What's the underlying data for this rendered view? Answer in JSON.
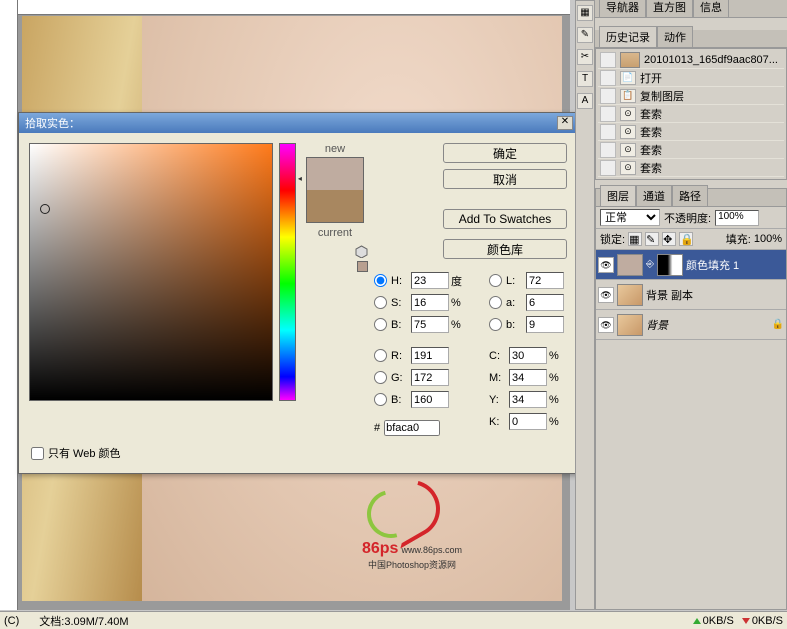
{
  "nav_tabs": {
    "navigator": "导航器",
    "histogram": "直方图",
    "info": "信息"
  },
  "history": {
    "tab_history": "历史记录",
    "tab_actions": "动作",
    "snapshot": "20101013_165df9aac807...",
    "items": [
      "打开",
      "复制图层",
      "套索",
      "套索",
      "套索",
      "套索"
    ]
  },
  "dialog": {
    "title": "拾取实色：",
    "new_label": "new",
    "current_label": "current",
    "ok": "确定",
    "cancel": "取消",
    "add_swatches": "Add To Swatches",
    "color_lib": "颜色库",
    "web_only": "只有 Web 颜色",
    "hsb": {
      "h_label": "H:",
      "s_label": "S:",
      "b_label": "B:",
      "h": "23",
      "s": "16",
      "b": "75",
      "h_unit": "度",
      "pct": "%"
    },
    "lab": {
      "l_label": "L:",
      "a_label": "a:",
      "b_label": "b:",
      "l": "72",
      "a": "6",
      "b": "9"
    },
    "rgb": {
      "r_label": "R:",
      "g_label": "G:",
      "b_label": "B:",
      "r": "191",
      "g": "172",
      "b": "160"
    },
    "cmyk": {
      "c_label": "C:",
      "m_label": "M:",
      "y_label": "Y:",
      "k_label": "K:",
      "c": "30",
      "m": "34",
      "y": "34",
      "k": "0",
      "pct": "%"
    },
    "hex_label": "#",
    "hex": "bfaca0",
    "new_color": "#bfaca0",
    "current_color": "#a88760"
  },
  "layers": {
    "tab_layers": "图层",
    "tab_channels": "通道",
    "tab_paths": "路径",
    "blend_mode": "正常",
    "opacity_label": "不透明度:",
    "opacity": "100%",
    "lock_label": "锁定:",
    "fill_label": "填充:",
    "fill": "100%",
    "rows": [
      {
        "name": "颜色填充 1"
      },
      {
        "name": "背景 副本"
      },
      {
        "name": "背景"
      }
    ]
  },
  "status": {
    "doc": "文档:3.09M/7.40M",
    "copyright": "(C)",
    "up": "0KB/S",
    "down": "0KB/S"
  },
  "watermark": {
    "brand": "86ps",
    "url": "www.86ps.com",
    "tagline": "中国Photoshop资源网"
  }
}
